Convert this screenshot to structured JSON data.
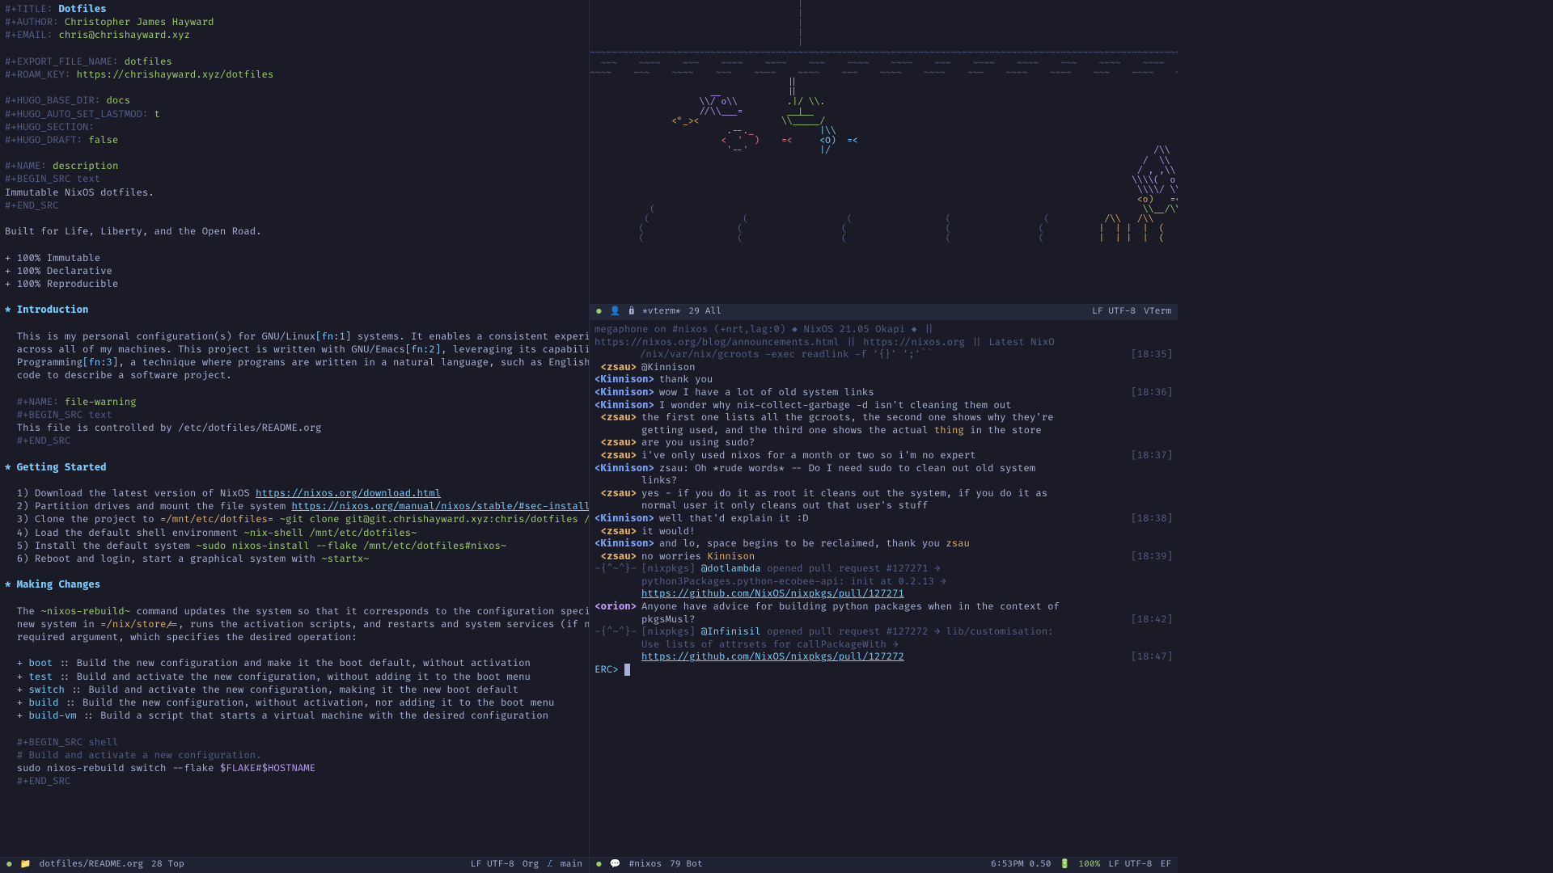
{
  "org": {
    "title_key": "#+TITLE:",
    "title_val": "Dotfiles",
    "author_key": "#+AUTHOR:",
    "author_val": "Christopher James Hayward",
    "email_key": "#+EMAIL:",
    "email_val": "chris@chrishayward.xyz",
    "export_key": "#+EXPORT_FILE_NAME:",
    "export_val": "dotfiles",
    "roam_key": "#+ROAM_KEY:",
    "roam_val": "https://chrishayward.xyz/dotfiles",
    "hugo_base_key": "#+HUGO_BASE_DIR:",
    "hugo_base_val": "docs",
    "hugo_lastmod_key": "#+HUGO_AUTO_SET_LASTMOD:",
    "hugo_lastmod_val": "t",
    "hugo_section_key": "#+HUGO_SECTION:",
    "hugo_draft_key": "#+HUGO_DRAFT:",
    "hugo_draft_val": "false",
    "name_desc_key": "#+NAME:",
    "name_desc_val": "description",
    "begin_src_text": "#+BEGIN_SRC text",
    "desc_body": "Immutable NixOS dotfiles.",
    "end_src": "#+END_SRC",
    "built_for": "Built for Life, Liberty, and the Open Road.",
    "bullet1": "+ 100% Immutable",
    "bullet2": "+ 100% Declarative",
    "bullet3": "+ 100% Reproducible",
    "intro_heading": "* Introduction",
    "intro_p1a": "  This is my personal configuration(s) for GNU/Linux",
    "intro_fn1": "[fn:1]",
    "intro_p1b": " systems. It enables a consistent experience and computing environment",
    "intro_p2a": "  across all of my machines. This project is written with GNU/Emacs",
    "intro_fn2": "[fn:2]",
    "intro_p2b": ", leveraging its capabilities for Literate",
    "intro_p3a": "  Programming",
    "intro_fn3": "[fn:3]",
    "intro_p3b": ", a technique where programs are written in a natural language, such as English, interspersed with snippets of",
    "intro_p4": "  code to describe a software project.",
    "name_fw_key": "  #+NAME:",
    "name_fw_val": "file-warning",
    "begin_src_text2": "  #+BEGIN_SRC text",
    "fw_body": "  This file is controlled by /etc/dotfiles/README.org",
    "end_src2": "  #+END_SRC",
    "getting_started": "* Getting Started",
    "gs1a": "  1) Download the latest version of NixOS ",
    "gs1_link": "https://nixos.org/download.html",
    "gs2a": "  2) Partition drives and mount the file system ",
    "gs2_link": "https://nixos.org/manual/nixos/stable/#sec-installation-partitioning",
    "gs3a": "  3) Clone the project to ",
    "gs3_code": "=/mnt/etc/dotfiles=",
    "gs3_cmd": " ~git clone git@git.chrishayward.xyz:chris/dotfiles /mnt/etc/dotfiles~",
    "gs4a": "  4) Load the default shell environment ",
    "gs4_cmd": "~nix-shell /mnt/etc/dotfiles~",
    "gs5a": "  5) Install the default system ",
    "gs5_cmd": "~sudo nixos-install --flake /mnt/etc/dotfiles#nixos~",
    "gs6a": "  6) Reboot and login, start a graphical system with ",
    "gs6_cmd": "~startx~",
    "making_changes": "* Making Changes",
    "mc_p1a": "  The ",
    "mc_code": "~nixos-rebuild~",
    "mc_p1b": " command updates the system so that it corresponds to the configuration specified in the module. It builds the",
    "mc_p2a": "  new system in ",
    "mc_code2": "=/nix/store/=",
    "mc_p2b": ", runs the activation scripts, and restarts and system services (if needed). The command has one",
    "mc_p3": "  required argument, which specifies the desired operation:",
    "mc_boot_k": "boot",
    "mc_boot": " :: Build the new configuration and make it the boot default, without activation",
    "mc_test_k": "test",
    "mc_test": " :: Build and activate the new configuration, without adding it to the boot menu",
    "mc_switch_k": "switch",
    "mc_switch": " :: Build and activate the new configuration, making it the new boot default",
    "mc_build_k": "build",
    "mc_build": " :: Build the new configuration, without activation, nor adding it to the boot menu",
    "mc_buildvm_k": "build-vm",
    "mc_buildvm": " :: Build a script that starts a virtual machine with the desired configuration",
    "begin_src_shell": "  #+BEGIN_SRC shell",
    "shell_comment": "  # Build and activate a new configuration.",
    "shell_cmd1": "  sudo nixos-rebuild switch --flake ",
    "shell_var1": "$FLAKE",
    "shell_hash": "#",
    "shell_var2": "$HOSTNAME",
    "end_src3": "  #+END_SRC"
  },
  "modeline_left": {
    "filename": "dotfiles/README.org",
    "position": "28 Top",
    "encoding": "LF UTF-8",
    "mode": "Org",
    "branch": "main"
  },
  "modeline_rt": {
    "buffer": "*vterm*",
    "position": "29 All",
    "encoding": "LF UTF-8",
    "mode": "VTerm"
  },
  "irc": {
    "topic": "megaphone on #nixos (+nrt,lag:0) ",
    "topic2": " NixOS 21.05 Okapi ",
    "topic3": " || https://nixos.org/blog/announcements.html || https://nixos.org || Latest NixO",
    "topic_line2": "/nix/var/nix/gcroots -exec readlink -f '{}' ';'``",
    "topic_time": "[18:35]",
    "lines": [
      {
        "nick": "zsau",
        "nc": "nick3",
        "msg": "@Kinnison"
      },
      {
        "nick": "Kinnison",
        "nc": "nick",
        "msg": "thank you"
      },
      {
        "nick": "Kinnison",
        "nc": "nick",
        "msg": "wow I have a lot of old system links",
        "time": "[18:36]"
      },
      {
        "nick": "Kinnison",
        "nc": "nick",
        "msg": "I wonder why nix-collect-garbage -d isn't cleaning them out"
      },
      {
        "nick": "zsau",
        "nc": "nick3",
        "msg": "the first one lists all the gcroots, the second one shows why they're"
      },
      {
        "nick": "",
        "nc": "",
        "msg": "getting used, and the third one shows the actual ",
        "msg2": "thing",
        "msg3": " in the store"
      },
      {
        "nick": "zsau",
        "nc": "nick3",
        "msg": "are you using sudo?"
      },
      {
        "nick": "zsau",
        "nc": "nick3",
        "msg": "i've only used nixos for a month or two so i'm no expert",
        "time": "[18:37]"
      },
      {
        "nick": "Kinnison",
        "nc": "nick",
        "msg": "zsau: Oh *rude words* -- Do I need sudo to clean out old system"
      },
      {
        "nick": "",
        "nc": "",
        "msg": "links?"
      },
      {
        "nick": "zsau",
        "nc": "nick3",
        "msg": "yes - if you do it as root it cleans out the system, if you do it as"
      },
      {
        "nick": "",
        "nc": "",
        "msg": "normal user it only cleans out that user's stuff"
      },
      {
        "nick": "Kinnison",
        "nc": "nick",
        "msg": "well that'd explain it :D",
        "time": "[18:38]"
      },
      {
        "nick": "zsau",
        "nc": "nick3",
        "msg": "it would!"
      },
      {
        "nick": "Kinnison",
        "nc": "nick",
        "msg": "and lo, space begins to be reclaimed, thank you ",
        "msg_hl": "zsau"
      },
      {
        "nick": "zsau",
        "nc": "nick3",
        "msg": "no worries ",
        "msg_hl": "Kinnison",
        "time": "[18:39]"
      }
    ],
    "pr1_prefix": "-{^~^}-",
    "pr1_a": " [nixpkgs] ",
    "pr1_user": "@dotlambda",
    "pr1_b": " opened pull request #127271 →",
    "pr1_c": "python3Packages.python-ecobee-api: init at 0.2.13 →",
    "pr1_link": "https://github.com/NixOS/nixpkgs/pull/127271",
    "orion_msg1": "Anyone have advice for building python packages when in the context of",
    "orion_msg2": "pkgsMusl?",
    "orion_time": "[18:42]",
    "pr2_prefix": "-{^~^}-",
    "pr2_a": " [nixpkgs] ",
    "pr2_user": "@Infinisil",
    "pr2_b": " opened pull request #127272 → lib/customisation:",
    "pr2_c": "Use lists of attrsets for callPackageWith →",
    "pr2_link": "https://github.com/NixOS/nixpkgs/pull/127272",
    "pr2_time": "[18:47]",
    "prompt": "ERC>"
  },
  "modeline_rb": {
    "channel": "#nixos",
    "position": "79 Bot",
    "clock": "6:53PM 0.50",
    "battery": "100%",
    "encoding": "LF UTF-8",
    "mode": "EF"
  }
}
